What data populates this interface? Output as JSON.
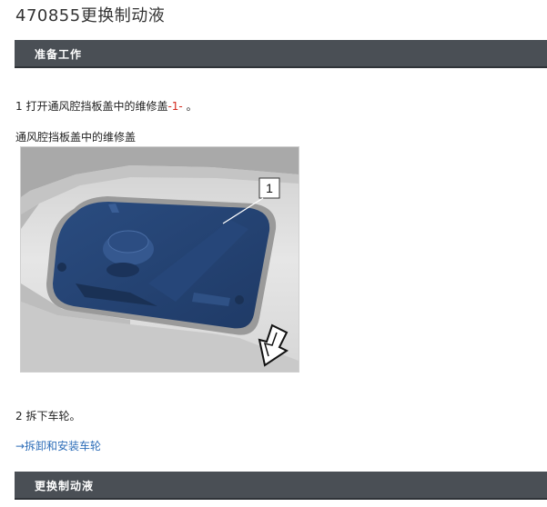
{
  "title": "470855更换制动液",
  "sections": {
    "prep": "准备工作",
    "replace": "更换制动液"
  },
  "steps": {
    "step1_prefix": "1 打开通风腔挡板盖中的维修盖",
    "step1_ref": "-1-",
    "step1_suffix": " 。",
    "step2": "2 拆下车轮。"
  },
  "figure": {
    "caption": "通风腔挡板盖中的维修盖",
    "callout_label": "1"
  },
  "link": {
    "label": "→拆卸和安装车轮"
  },
  "colors": {
    "section_bar": "#4a4f55",
    "reference_red": "#d42a1e",
    "link_blue": "#2d6db8",
    "highlight_blue": "#23406e"
  }
}
